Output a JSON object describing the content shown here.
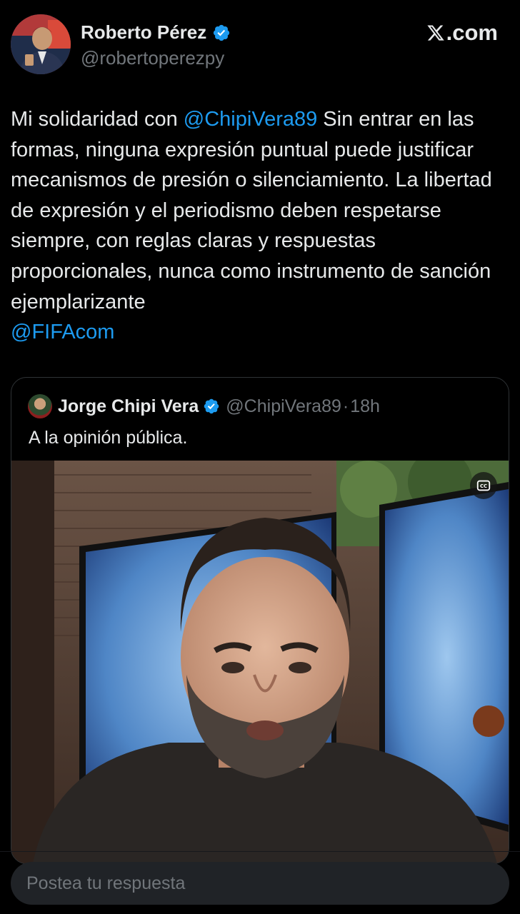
{
  "header": {
    "author_name": "Roberto Pérez",
    "author_handle": "@robertoperezpy",
    "source_label": ".com"
  },
  "tweet": {
    "text_before_mention": "Mi solidaridad con ",
    "mention_1": "@ChipiVera89",
    "text_after_mention": " Sin entrar en las formas, ninguna expresión puntual puede justificar mecanismos de presión o silenciamiento. La libertad de expresión y el periodismo deben respetarse siempre, con reglas claras y respuestas proporcionales, nunca como instrumento de sanción ejemplarizante",
    "mention_2": "@FIFAcom"
  },
  "quote": {
    "author_name": "Jorge Chipi Vera",
    "author_handle": "@ChipiVera89",
    "separator": "·",
    "time": "18h",
    "text": "A la opinión pública."
  },
  "reply": {
    "placeholder": "Postea tu respuesta"
  },
  "colors": {
    "background": "#000000",
    "text": "#e7e9ea",
    "muted": "#71767b",
    "accent": "#1d9bf0"
  },
  "icons": [
    "x-logo-icon",
    "verified-badge-icon",
    "closed-captions-icon"
  ]
}
